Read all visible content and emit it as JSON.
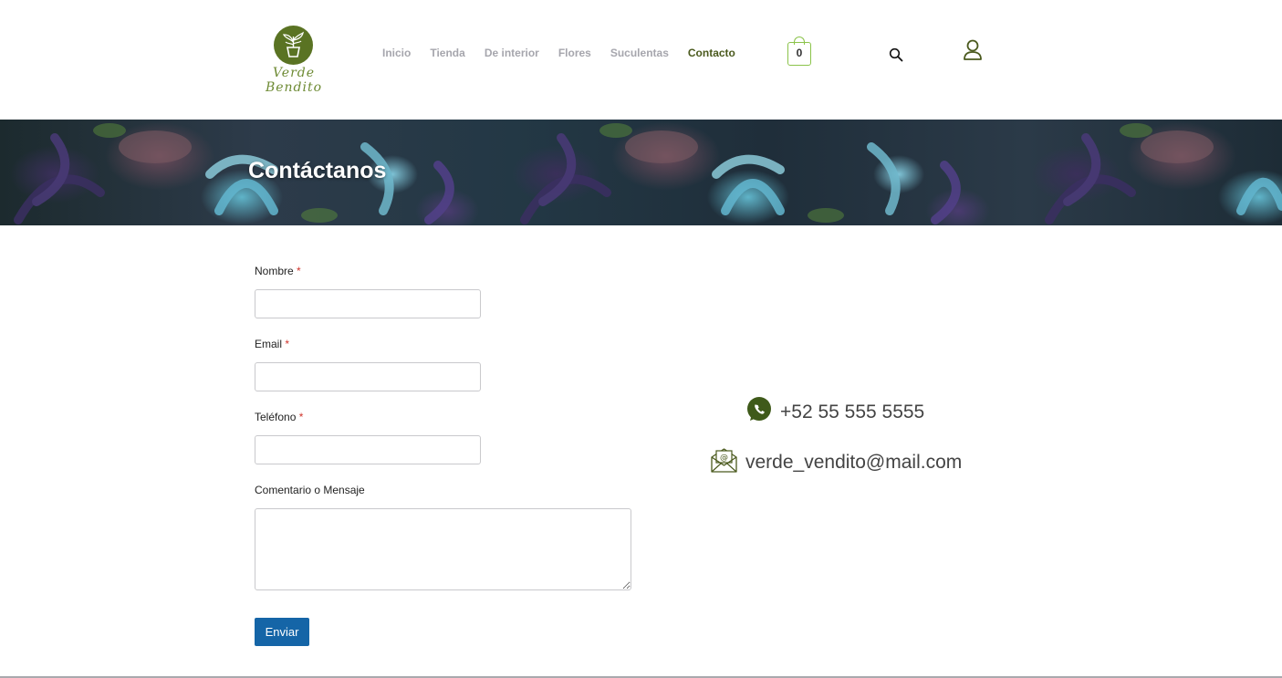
{
  "header": {
    "logo_text": "Verde Bendito",
    "nav": [
      {
        "label": "Inicio",
        "active": false
      },
      {
        "label": "Tienda",
        "active": false
      },
      {
        "label": "De interior",
        "active": false
      },
      {
        "label": "Flores",
        "active": false
      },
      {
        "label": "Suculentas",
        "active": false
      },
      {
        "label": "Contacto",
        "active": true
      }
    ],
    "cart_count": "0",
    "icons": {
      "cart": "shopping-bag-icon",
      "search": "search-icon",
      "account": "user-icon"
    }
  },
  "banner": {
    "title": "Contáctanos"
  },
  "form": {
    "fields": [
      {
        "label": "Nombre",
        "required_mark": "*",
        "value": ""
      },
      {
        "label": "Email",
        "required_mark": "*",
        "value": ""
      },
      {
        "label": "Teléfono",
        "required_mark": "*",
        "value": ""
      }
    ],
    "message": {
      "label": "Comentario o Mensaje",
      "value": ""
    },
    "submit_label": "Enviar"
  },
  "contact": {
    "phone": "+52 55 555 5555",
    "email": "verde_vendito@mail.com",
    "icons": {
      "phone": "whatsapp-icon",
      "email": "email-envelope-icon"
    }
  },
  "colors": {
    "brand_green": "#5a7323",
    "nav_inactive": "#a6a6ad",
    "nav_active": "#4b5a1e",
    "cart_outline": "#8bc34a",
    "button_blue": "#1565a7",
    "required_red": "#d0342c"
  }
}
